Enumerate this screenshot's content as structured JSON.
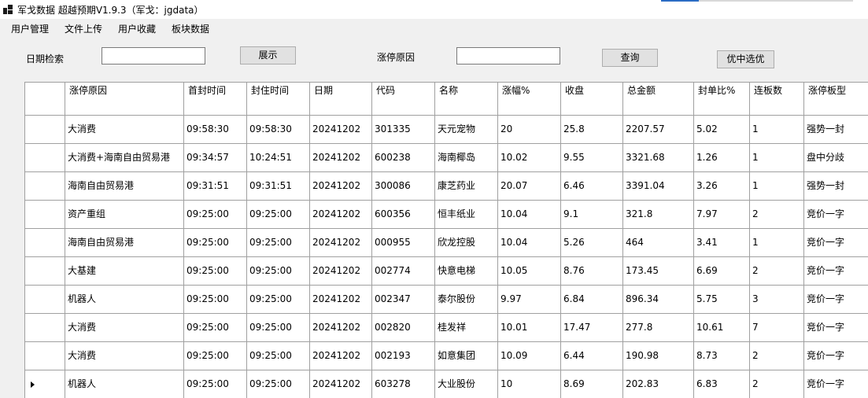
{
  "window": {
    "title": "军戈数据 超越预期V1.9.3（军戈：jgdata）"
  },
  "menu": {
    "items": [
      "用户管理",
      "文件上传",
      "用户收藏",
      "板块数据"
    ]
  },
  "toolbar": {
    "date_label": "日期检索",
    "date_value": "",
    "show_button": "展示",
    "reason_label": "涨停原因",
    "reason_value": "",
    "query_button": "查询",
    "pick_button": "优中选优"
  },
  "table": {
    "columns": [
      "涨停原因",
      "首封时间",
      "封住时间",
      "日期",
      "代码",
      "名称",
      "涨幅%",
      "收盘",
      "总金额",
      "封单比%",
      "连板数",
      "涨停板型"
    ],
    "rows": [
      [
        "大消费",
        "09:58:30",
        "09:58:30",
        "20241202",
        "301335",
        "天元宠物",
        "20",
        "25.8",
        "2207.57",
        "5.02",
        "1",
        "强势一封"
      ],
      [
        "大消费+海南自由贸易港",
        "09:34:57",
        "10:24:51",
        "20241202",
        "600238",
        "海南椰岛",
        "10.02",
        "9.55",
        "3321.68",
        "1.26",
        "1",
        "盘中分歧"
      ],
      [
        "海南自由贸易港",
        "09:31:51",
        "09:31:51",
        "20241202",
        "300086",
        "康芝药业",
        "20.07",
        "6.46",
        "3391.04",
        "3.26",
        "1",
        "强势一封"
      ],
      [
        "资产重组",
        "09:25:00",
        "09:25:00",
        "20241202",
        "600356",
        "恒丰纸业",
        "10.04",
        "9.1",
        "321.8",
        "7.97",
        "2",
        "竞价一字"
      ],
      [
        "海南自由贸易港",
        "09:25:00",
        "09:25:00",
        "20241202",
        "000955",
        "欣龙控股",
        "10.04",
        "5.26",
        "464",
        "3.41",
        "1",
        "竞价一字"
      ],
      [
        "大基建",
        "09:25:00",
        "09:25:00",
        "20241202",
        "002774",
        "快意电梯",
        "10.05",
        "8.76",
        "173.45",
        "6.69",
        "2",
        "竞价一字"
      ],
      [
        "机器人",
        "09:25:00",
        "09:25:00",
        "20241202",
        "002347",
        "泰尔股份",
        "9.97",
        "6.84",
        "896.34",
        "5.75",
        "3",
        "竞价一字"
      ],
      [
        "大消费",
        "09:25:00",
        "09:25:00",
        "20241202",
        "002820",
        "桂发祥",
        "10.01",
        "17.47",
        "277.8",
        "10.61",
        "7",
        "竞价一字"
      ],
      [
        "大消费",
        "09:25:00",
        "09:25:00",
        "20241202",
        "002193",
        "如意集团",
        "10.09",
        "6.44",
        "190.98",
        "8.73",
        "2",
        "竞价一字"
      ],
      [
        "机器人",
        "09:25:00",
        "09:25:00",
        "20241202",
        "603278",
        "大业股份",
        "10",
        "8.69",
        "202.83",
        "6.83",
        "2",
        "竞价一字"
      ]
    ],
    "current_row": 9
  }
}
